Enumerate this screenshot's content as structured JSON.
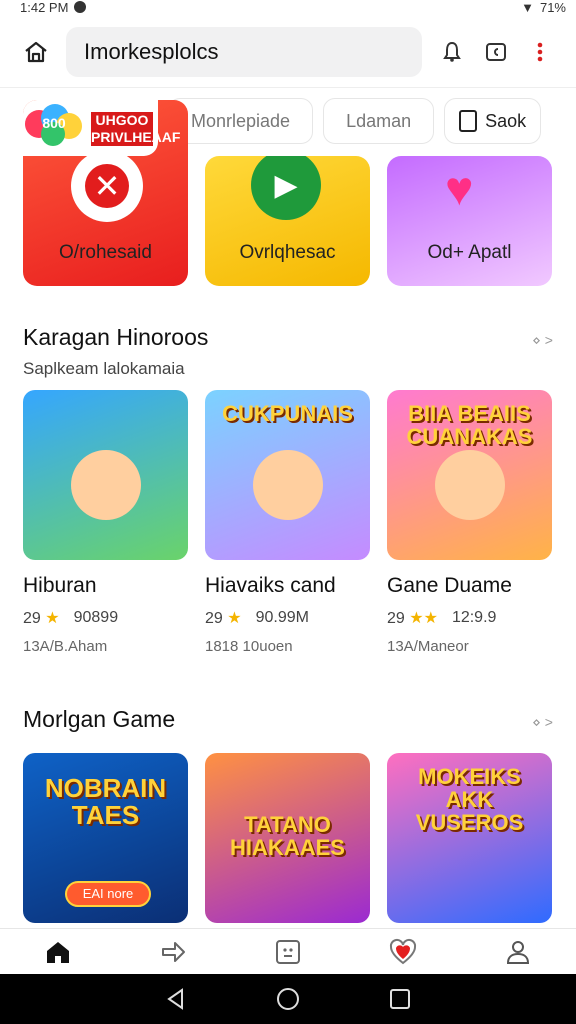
{
  "status_bar": {
    "time": "1:42 PM",
    "battery": "71%"
  },
  "header": {
    "search_text": "Imorkesplolcs"
  },
  "chips": [
    {
      "label": "Monrlepiade"
    },
    {
      "label": "Ldaman"
    },
    {
      "label": "Saok"
    }
  ],
  "promos": [
    {
      "label": "O/rohesaid",
      "badge_text": "UHGOO PRIVLHEAAF",
      "balloon_text": "800"
    },
    {
      "label": "Ovrlqhesac"
    },
    {
      "label": "Od+ Apatl"
    }
  ],
  "sections": [
    {
      "title": "Karagan Hinoroos",
      "subtitle": "Saplkeam lalokamaia",
      "more": "⋄ >",
      "games": [
        {
          "thumb_title": "",
          "name": "Hiburan",
          "rating": "29",
          "count": "90899",
          "sub": "13A/B.Aham"
        },
        {
          "thumb_title": "CUKPUNAIS",
          "name": "Hiavaiks cand",
          "rating": "29",
          "count": "90.99M",
          "sub": "1818 10uoen"
        },
        {
          "thumb_title": "BIIA BEAIIS CUANAKAS",
          "name": "Gane Duame",
          "rating": "29",
          "count": "12:9.9",
          "sub": "13A/Maneor"
        }
      ]
    },
    {
      "title": "Morlgan Game",
      "more": "⋄ >",
      "games": [
        {
          "thumb_title": "NOBRAIN TAES",
          "pill": "EAI nore"
        },
        {
          "thumb_title": "TATANO HIAKAAES"
        },
        {
          "thumb_title": "MOKEIKS AKK VUSEROS"
        }
      ]
    }
  ]
}
